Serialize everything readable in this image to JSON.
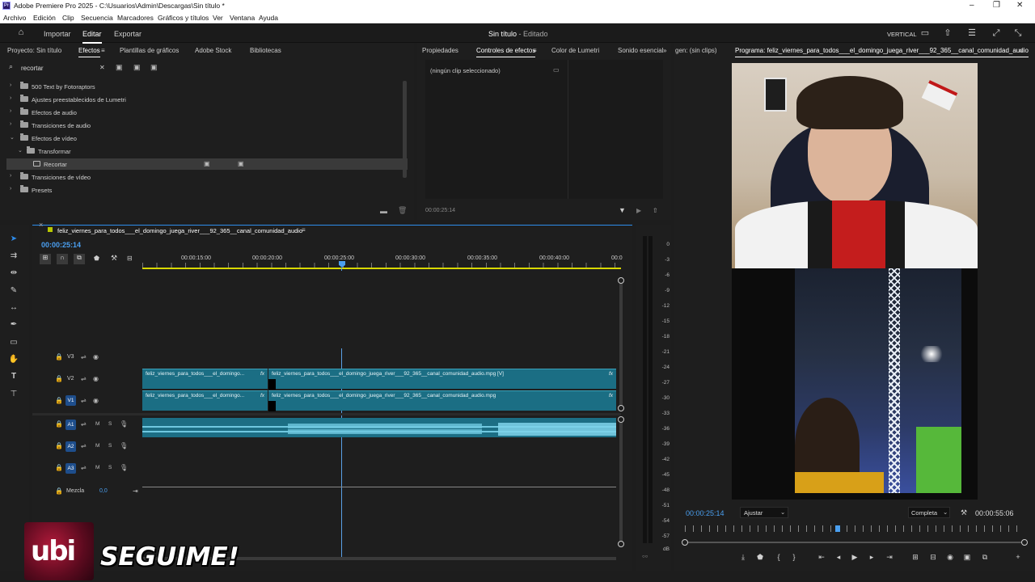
{
  "window": {
    "title": "Adobe Premiere Pro 2025 - C:\\Usuarios\\Admin\\Descargas\\Sin título *",
    "logo": "Pr"
  },
  "menu": [
    "Archivo",
    "Edición",
    "Clip",
    "Secuencia",
    "Marcadores",
    "Gráficos y títulos",
    "Ver",
    "Ventana",
    "Ayuda"
  ],
  "header": {
    "nav": [
      "Importar",
      "Editar",
      "Exportar"
    ],
    "active": "Editar",
    "project_title": "Sin título",
    "separator": " - ",
    "status": "Editado",
    "orientation": "VERTICAL"
  },
  "effects_panel": {
    "tabs": [
      "Proyecto: Sin título",
      "Efectos",
      "Plantillas de gráficos",
      "Adobe Stock",
      "Bibliotecas"
    ],
    "active_tab": "Efectos",
    "search_value": "recortar",
    "tree": [
      {
        "label": "500 Text by Fotoraptors",
        "level": 0,
        "expanded": false
      },
      {
        "label": "Ajustes preestablecidos de Lumetri",
        "level": 0,
        "expanded": false
      },
      {
        "label": "Efectos de audio",
        "level": 0,
        "expanded": false
      },
      {
        "label": "Transiciones de audio",
        "level": 0,
        "expanded": false
      },
      {
        "label": "Efectos de vídeo",
        "level": 0,
        "expanded": true
      },
      {
        "label": "Transformar",
        "level": 1,
        "expanded": true
      },
      {
        "label": "Recortar",
        "level": 2,
        "selected": true
      },
      {
        "label": "Transiciones de vídeo",
        "level": 0,
        "expanded": false
      },
      {
        "label": "Presets",
        "level": 0,
        "expanded": false
      }
    ]
  },
  "effect_controls": {
    "tabs": [
      "Propiedades",
      "Controles de efectos",
      "Color de Lumetri",
      "Sonido esencial"
    ],
    "active_tab": "Controles de efectos",
    "no_clip": "(ningún clip seleccionado)",
    "timecode": "00:00:25:14"
  },
  "program_monitor": {
    "source_tab": "gen: (sin clips)",
    "program_tab": "Programa: feliz_viernes_para_todos___el_domingo_juega_river___92_365__canal_comunidad_audio",
    "timecode_current": "00:00:25:14",
    "fit": "Ajustar",
    "quality": "Completa",
    "timecode_total": "00:00:55:06",
    "playhead_fraction": 0.45
  },
  "timeline": {
    "sequence_name": "feliz_viernes_para_todos___el_domingo_juega_river___92_365__canal_comunidad_audio",
    "timecode": "00:00:25:14",
    "ruler_labels": [
      "00:00:15:00",
      "00:00:20:00",
      "00:00:25:00",
      "00:00:30:00",
      "00:00:35:00",
      "00:00:40:00",
      "00:0"
    ],
    "video_tracks": [
      "V3",
      "V2",
      "V1"
    ],
    "audio_tracks": [
      "A1",
      "A2",
      "A3"
    ],
    "mix_label": "Mezcla",
    "mix_value": "0,0",
    "track_m": "M",
    "track_s": "S",
    "clips": {
      "v2_short": "feliz_viernes_para_todos___el_domingo...",
      "v2_long": "feliz_viernes_para_todos___el_domingo_juega_river___92_365__canal_comunidad_audio.mpg [V]",
      "v1_short": "feliz_viernes_para_todos___el_domingo...",
      "v1_long": "feliz_viernes_para_todos___el_domingo_juega_river___92_365__canal_comunidad_audio.mpg",
      "fx": "fx"
    }
  },
  "audio_meter": {
    "labels": [
      "0",
      "-3",
      "-6",
      "-9",
      "-12",
      "-15",
      "-18",
      "-21",
      "-24",
      "-27",
      "-30",
      "-33",
      "-36",
      "-39",
      "-42",
      "-45",
      "-48",
      "-51",
      "-54",
      "-57",
      "dB"
    ]
  },
  "overlay": {
    "logo_text": "ubi",
    "cta": "SEGUIME!"
  },
  "colors": {
    "accent_blue": "#2d8ceb",
    "clip_teal": "#1b6e84",
    "track_badge": "#1e4e8c",
    "playhead": "#5aa0e6",
    "timecode_blue": "#4a9ff0"
  }
}
